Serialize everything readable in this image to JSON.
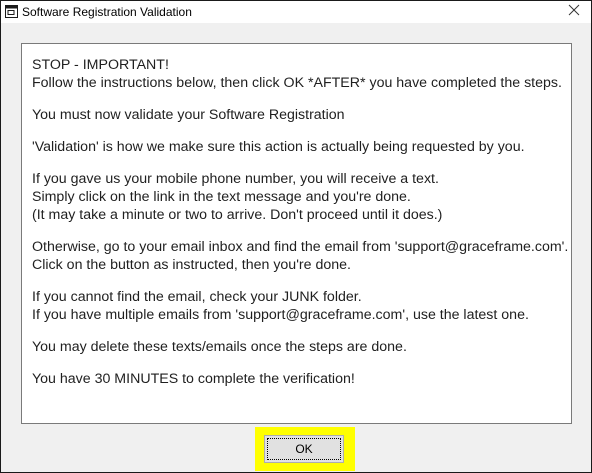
{
  "window": {
    "title": "Software Registration Validation",
    "icon": "app-window-icon",
    "close_icon": "close-icon"
  },
  "message": {
    "paragraphs": [
      {
        "lines": [
          "STOP - IMPORTANT!",
          "Follow the instructions below, then click OK *AFTER* you have completed the steps."
        ]
      },
      {
        "lines": [
          "You must now validate your Software Registration"
        ]
      },
      {
        "lines": [
          "'Validation' is how we make sure this action is actually being requested by you."
        ]
      },
      {
        "lines": [
          "If you gave us your mobile phone number, you will receive a text.",
          "Simply click on the link in the text message and you're done.",
          "(It may take a minute or two to arrive. Don't proceed until it does.)"
        ]
      },
      {
        "lines": [
          "Otherwise, go to your email inbox and find the email from 'support@graceframe.com'.",
          "Click on the button as instructed, then you're done."
        ]
      },
      {
        "lines": [
          "If you cannot find the email, check your JUNK folder.",
          "If you have multiple emails from 'support@graceframe.com', use the latest one."
        ]
      },
      {
        "lines": [
          "You may delete these texts/emails once the steps are done."
        ]
      },
      {
        "lines": [
          "You have 30 MINUTES to complete the verification!"
        ]
      }
    ]
  },
  "buttons": {
    "ok_label": "OK"
  },
  "colors": {
    "highlight": "#ffff00",
    "dialog_background": "#f0f0f0"
  }
}
